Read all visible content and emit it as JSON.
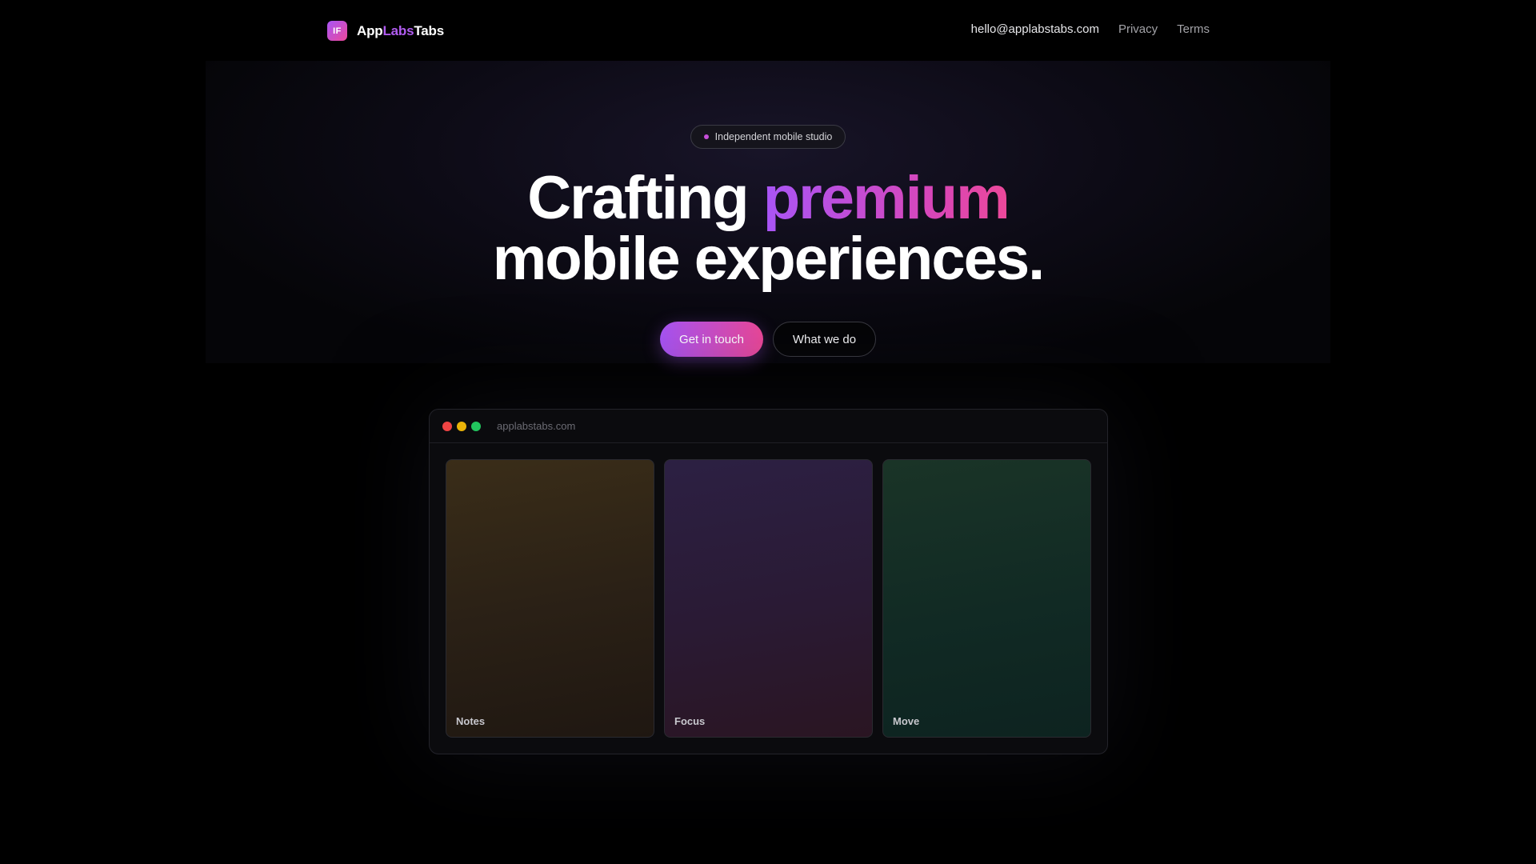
{
  "brand": {
    "icon_text": "IF",
    "name_part1": "App",
    "name_part2": "Labs",
    "name_part3": "Tabs",
    "accent_color": "#b15cf0"
  },
  "nav": {
    "email": "hello@applabstabs.com",
    "privacy": "Privacy",
    "terms": "Terms"
  },
  "hero": {
    "badge": "Independent mobile studio",
    "headline_part1": "Crafting ",
    "headline_highlight": "premium",
    "headline_part2": "mobile experiences.",
    "cta_primary": "Get in touch",
    "cta_secondary": "What we do",
    "gradient_start": "#a855f7",
    "gradient_end": "#ec4899"
  },
  "mockup": {
    "url": "applabstabs.com",
    "cards": [
      {
        "label": "Notes"
      },
      {
        "label": "Focus"
      },
      {
        "label": "Move"
      }
    ]
  }
}
